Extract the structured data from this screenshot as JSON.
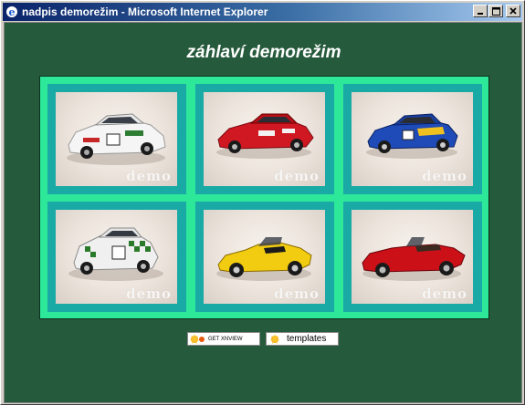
{
  "window": {
    "title": "nadpis demorežim - Microsoft Internet Explorer",
    "controls": {
      "minimize": "_",
      "maximize": "□",
      "close": "×"
    }
  },
  "page": {
    "heading": "záhlaví demorežim",
    "colors": {
      "background": "#265a3c",
      "frame": "#2ee89a",
      "cell": "#19aaa6"
    }
  },
  "gallery": {
    "watermark": "demo",
    "items": [
      {
        "subject": "white rally car",
        "color": "#f4f4f4",
        "accent": "#2e7d32"
      },
      {
        "subject": "red coupe",
        "color": "#d01822",
        "accent": "#f2f2f2"
      },
      {
        "subject": "blue rally car",
        "color": "#1e4bb8",
        "accent": "#f0c020"
      },
      {
        "subject": "white rally hatchback",
        "color": "#f0f0f0",
        "accent": "#2a7a2a"
      },
      {
        "subject": "yellow roadster",
        "color": "#f2cc10",
        "accent": "#1a1a1a"
      },
      {
        "subject": "red convertible",
        "color": "#cc1018",
        "accent": "#3a2a20"
      }
    ]
  },
  "footer": {
    "badges": [
      {
        "label": "GET XNVIEW",
        "icon": "xnview-logo-icon"
      },
      {
        "label": "templates",
        "icon": "xnview-logo-icon"
      }
    ]
  }
}
